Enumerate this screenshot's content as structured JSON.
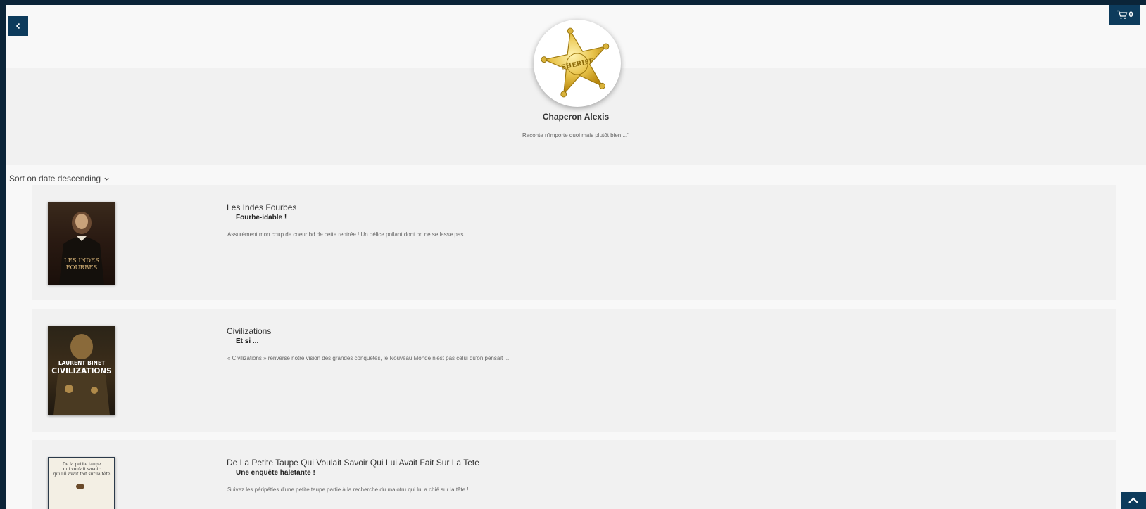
{
  "header": {
    "back_label": "",
    "cart_count": "0"
  },
  "profile": {
    "name": "Chaperon Alexis",
    "bio": "Raconte n'importe quoi mais plutôt bien ...\"",
    "avatar_icon": "sheriff-star-badge",
    "avatar_text": "SHERIFF"
  },
  "sort": {
    "label": "Sort on date descending"
  },
  "reviews": [
    {
      "book_title": "Les Indes Fourbes",
      "review_title": "Fourbe-idable !",
      "excerpt": "Assurément mon coup de coeur bd de cette rentrée ! Un délice poilant dont on ne se lasse pas ...",
      "cover_text": "LES INDES FOURBES"
    },
    {
      "book_title": "Civilizations",
      "review_title": "Et si ...",
      "excerpt": "« Civilizations » renverse notre vision des grandes conquêtes, le Nouveau Monde n'est pas celui qu'on pensait ...",
      "cover_author": "LAURENT BINET",
      "cover_text": "CIVILIZATIONS"
    },
    {
      "book_title": "De La Petite Taupe Qui Voulait Savoir Qui Lui Avait Fait Sur La Tete",
      "review_title": "Une enquête haletante !",
      "excerpt": "Suivez les péripéties d'une petite taupe partie à la recherche du malotru qui lui a chié sur la tête !",
      "cover_text": "De la petite taupe qui voulait savoir qui lui avait fait sur la tête"
    }
  ],
  "colors": {
    "accent": "#0d3b5c",
    "page_bg": "#f8f8f8",
    "card_bg": "#f1f1f1",
    "frame": "#0b2438"
  }
}
